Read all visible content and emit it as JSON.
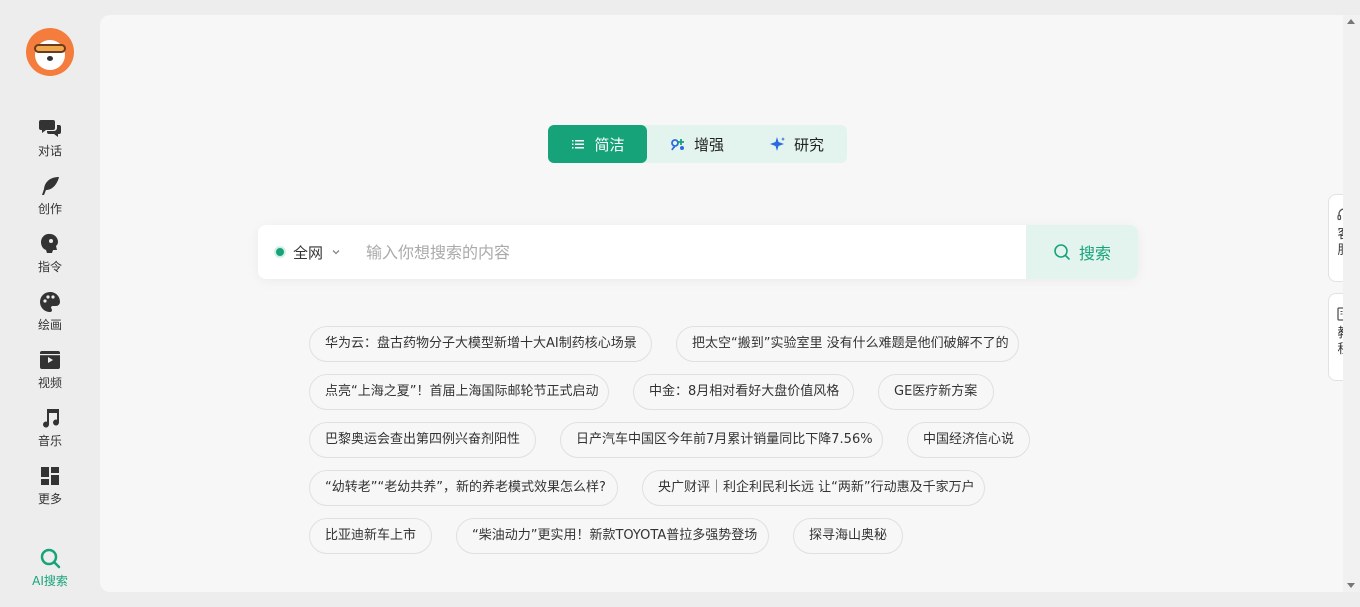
{
  "sidebar": {
    "items": [
      {
        "label": "对话",
        "icon": "chat-icon"
      },
      {
        "label": "创作",
        "icon": "feather-icon"
      },
      {
        "label": "指令",
        "icon": "command-icon"
      },
      {
        "label": "绘画",
        "icon": "palette-icon"
      },
      {
        "label": "视频",
        "icon": "video-icon"
      },
      {
        "label": "音乐",
        "icon": "music-icon"
      },
      {
        "label": "更多",
        "icon": "grid-icon"
      }
    ],
    "active_item": {
      "label": "AI搜索",
      "icon": "ai-search-icon"
    }
  },
  "modes": [
    {
      "label": "简洁",
      "icon": "list-icon"
    },
    {
      "label": "增强",
      "icon": "enhance-icon"
    },
    {
      "label": "研究",
      "icon": "sparkle-icon"
    }
  ],
  "search": {
    "scope": "全网",
    "placeholder": "输入你想搜索的内容",
    "button_label": "搜索"
  },
  "suggestions": [
    "华为云：盘古药物分子大模型新增十大AI制药核心场景",
    "把太空“搬到”实验室里 没有什么难题是他们破解不了的",
    "点亮“上海之夏”！首届上海国际邮轮节正式启动",
    "中金：8月相对看好大盘价值风格",
    "GE医疗新方案",
    "巴黎奥运会查出第四例兴奋剂阳性",
    "日产汽车中国区今年前7月累计销量同比下降7.56%",
    "中国经济信心说",
    "“幼转老”“老幼共养”，新的养老模式效果怎么样?",
    "央广财评｜利企利民利长远 让“两新”行动惠及千家万户",
    "比亚迪新车上市",
    "“柴油动力”更实用！新款TOYOTA普拉多强势登场",
    "探寻海山奥秘"
  ],
  "float_buttons": [
    {
      "label": "客服",
      "icon": "headset-icon"
    },
    {
      "label": "教程",
      "icon": "book-icon"
    }
  ],
  "colors": {
    "accent": "#17a37a",
    "accent_light": "#e3f4ef",
    "logo": "#f47c3c"
  }
}
